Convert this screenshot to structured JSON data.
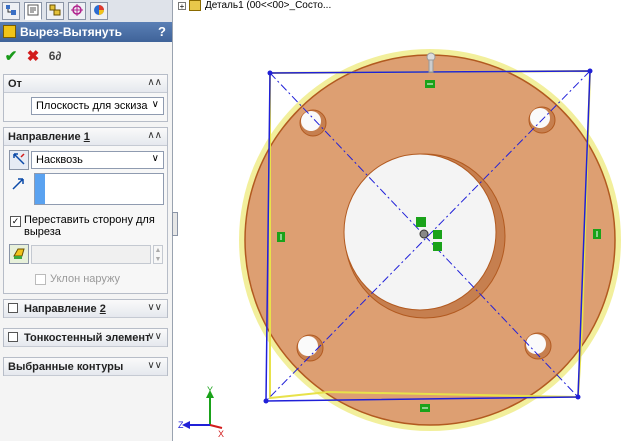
{
  "tabs": [
    {
      "name": "feature-manager-tab",
      "icon": "feature-tree-icon"
    },
    {
      "name": "property-manager-tab",
      "icon": "property-icon"
    },
    {
      "name": "configuration-manager-tab",
      "icon": "configuration-icon"
    },
    {
      "name": "dimxpert-tab",
      "icon": "crosshair-icon"
    },
    {
      "name": "display-manager-tab",
      "icon": "appearance-icon"
    }
  ],
  "property_manager": {
    "title": "Вырез-Вытянуть",
    "help": "?",
    "actions": {
      "ok": "✔",
      "cancel": "✖",
      "preview": "6∂"
    },
    "from": {
      "label": "От",
      "value": "Плоскость для эскиза"
    },
    "direction1": {
      "label": "Направление",
      "number": "1",
      "end_condition": "Насквозь",
      "flip_side_label": "Переставить сторону для выреза",
      "flip_side_checked": true,
      "draft_outward_label": "Уклон наружу",
      "draft_outward_checked": false
    },
    "direction2": {
      "label": "Направление",
      "number": "2",
      "checked": false
    },
    "thin_feature": {
      "label": "Тонкостенный элемент",
      "checked": false
    },
    "selected_contours": {
      "label": "Выбранные контуры"
    }
  },
  "feature_tree": {
    "expand": "+",
    "part": "Деталь1  (00<<00>_Состо..."
  },
  "triad": {
    "x": "X",
    "y": "Y",
    "z": "Z"
  },
  "colors": {
    "part_face": "#dd9f72",
    "part_edge": "#b25a20",
    "selection": "#e8e24a",
    "sketch": "#2020d8",
    "relation": "#1aa21a",
    "title_bar": "#4a6fa8"
  }
}
